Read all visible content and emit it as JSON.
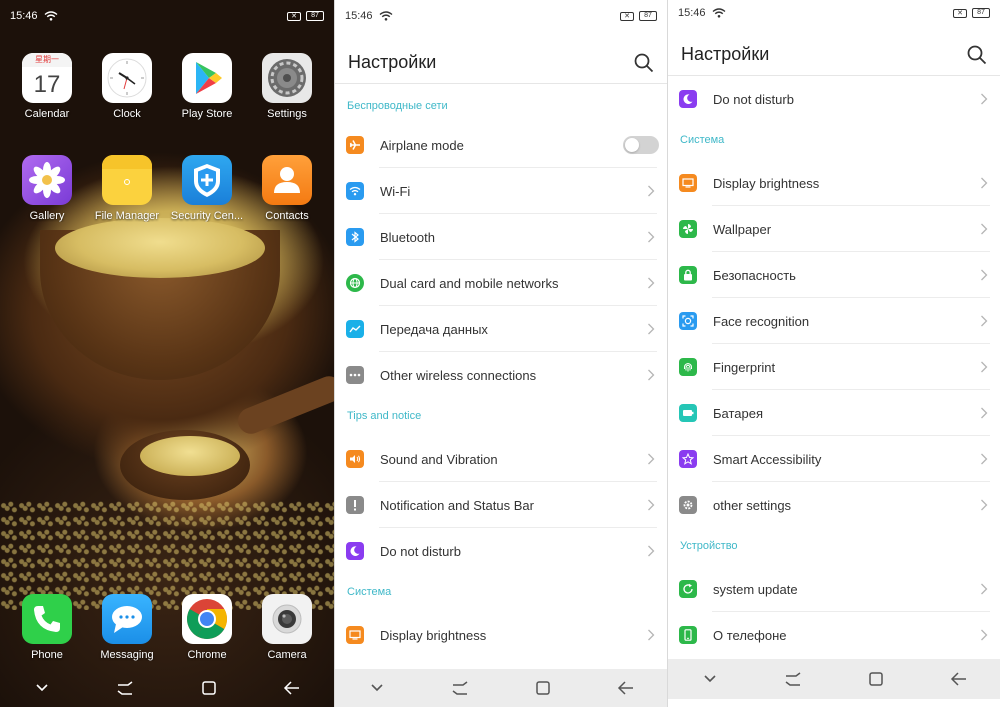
{
  "colors": {
    "section_header": "#3fb8c8",
    "orange": "#f58a1f",
    "blue": "#2a9bf0",
    "green": "#2db84a",
    "gray": "#8a8a8a",
    "purple": "#8a3cf0",
    "teal": "#25c6b6",
    "cyan": "#1ab0e8",
    "navbar_bg": "#ececec"
  },
  "home": {
    "status": {
      "time": "15:46",
      "battery": "87"
    },
    "apps_row1": [
      {
        "label": "Calendar",
        "icon": "calendar-icon",
        "cal_weekday": "星期一",
        "cal_day": "17"
      },
      {
        "label": "Clock",
        "icon": "clock-icon"
      },
      {
        "label": "Play Store",
        "icon": "play-store-icon"
      },
      {
        "label": "Settings",
        "icon": "settings-gear-icon"
      }
    ],
    "apps_row2": [
      {
        "label": "Gallery",
        "icon": "gallery-flower-icon"
      },
      {
        "label": "File Manager",
        "icon": "folder-icon"
      },
      {
        "label": "Security Cen...",
        "icon": "shield-icon"
      },
      {
        "label": "Contacts",
        "icon": "contact-person-icon"
      }
    ],
    "dock": [
      {
        "label": "Phone",
        "icon": "phone-icon"
      },
      {
        "label": "Messaging",
        "icon": "message-bubble-icon"
      },
      {
        "label": "Chrome",
        "icon": "chrome-icon"
      },
      {
        "label": "Camera",
        "icon": "camera-icon"
      }
    ]
  },
  "settings1": {
    "status": {
      "time": "15:46",
      "battery": "87"
    },
    "title": "Настройки",
    "section_wireless": "Беспроводные сети",
    "airplane": "Airplane mode",
    "airplane_on": false,
    "wifi": "Wi-Fi",
    "bluetooth": "Bluetooth",
    "dual_card": "Dual card and mobile networks",
    "data_transfer": "Передача данных",
    "other_wireless": "Other wireless connections",
    "section_tips": "Tips and notice",
    "sound": "Sound and Vibration",
    "notification": "Notification and Status Bar",
    "dnd": "Do not disturb",
    "section_system": "Система",
    "display": "Display brightness"
  },
  "settings2": {
    "status": {
      "time": "15:46",
      "battery": "87"
    },
    "title": "Настройки",
    "dnd": "Do not disturb",
    "section_system": "Система",
    "display": "Display brightness",
    "wallpaper": "Wallpaper",
    "security": "Безопасность",
    "face": "Face recognition",
    "fingerprint": "Fingerprint",
    "battery": "Батарея",
    "accessibility": "Smart Accessibility",
    "other": "other settings",
    "section_device": "Устройство",
    "update": "system update",
    "about": "О телефоне"
  }
}
